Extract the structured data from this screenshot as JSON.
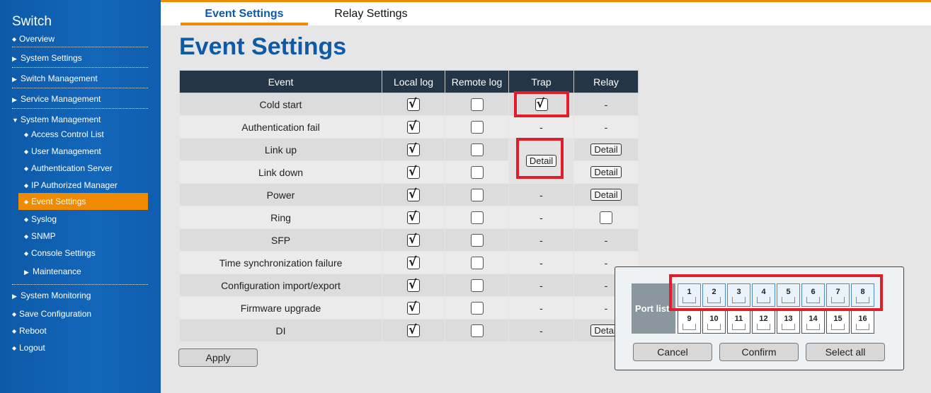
{
  "sidebar": {
    "title": "Switch",
    "items": [
      {
        "label": "Overview"
      },
      {
        "label": "System Settings"
      },
      {
        "label": "Switch Management"
      },
      {
        "label": "Service Management"
      },
      {
        "label": "System Management"
      },
      {
        "label": "Access Control List"
      },
      {
        "label": "User Management"
      },
      {
        "label": "Authentication Server"
      },
      {
        "label": "IP Authorized Manager"
      },
      {
        "label": "Event Settings"
      },
      {
        "label": "Syslog"
      },
      {
        "label": "SNMP"
      },
      {
        "label": "Console Settings"
      },
      {
        "label": "Maintenance"
      },
      {
        "label": "System Monitoring"
      },
      {
        "label": "Save Configuration"
      },
      {
        "label": "Reboot"
      },
      {
        "label": "Logout"
      }
    ]
  },
  "tabs": {
    "event": "Event Settings",
    "relay": "Relay Settings"
  },
  "page_title": "Event Settings",
  "table": {
    "headers": [
      "Event",
      "Local log",
      "Remote log",
      "Trap",
      "Relay"
    ],
    "rows": [
      {
        "event": "Cold start",
        "local": true,
        "remote": false,
        "trap": "checked",
        "relay": "-"
      },
      {
        "event": "Authentication fail",
        "local": true,
        "remote": false,
        "trap": "-",
        "relay": "-"
      },
      {
        "event": "Link up",
        "local": true,
        "remote": false,
        "trap": "Detail",
        "relay": "Detail"
      },
      {
        "event": "Link down",
        "local": true,
        "remote": false,
        "trap": "",
        "relay": "Detail"
      },
      {
        "event": "Power",
        "local": true,
        "remote": false,
        "trap": "-",
        "relay": "Detail"
      },
      {
        "event": "Ring",
        "local": true,
        "remote": false,
        "trap": "-",
        "relay": "unchecked"
      },
      {
        "event": "SFP",
        "local": true,
        "remote": false,
        "trap": "-",
        "relay": "-"
      },
      {
        "event": "Time synchronization failure",
        "local": true,
        "remote": false,
        "trap": "-",
        "relay": "-"
      },
      {
        "event": "Configuration import/export",
        "local": true,
        "remote": false,
        "trap": "-",
        "relay": "-"
      },
      {
        "event": "Firmware upgrade",
        "local": true,
        "remote": false,
        "trap": "-",
        "relay": "-"
      },
      {
        "event": "DI",
        "local": true,
        "remote": false,
        "trap": "-",
        "relay": "Detail"
      }
    ]
  },
  "apply_label": "Apply",
  "dash": "-",
  "detail_label": "Detail",
  "popup": {
    "port_label": "Port list",
    "ports_row1": [
      "1",
      "2",
      "3",
      "4",
      "5",
      "6",
      "7",
      "8"
    ],
    "ports_row2": [
      "9",
      "10",
      "11",
      "12",
      "13",
      "14",
      "15",
      "16"
    ],
    "cancel": "Cancel",
    "confirm": "Confirm",
    "select_all": "Select all"
  },
  "colors": {
    "accent": "#f08a00",
    "sidebar": "#1366b9",
    "title": "#0d5aa8",
    "highlight": "#e01e2a"
  }
}
